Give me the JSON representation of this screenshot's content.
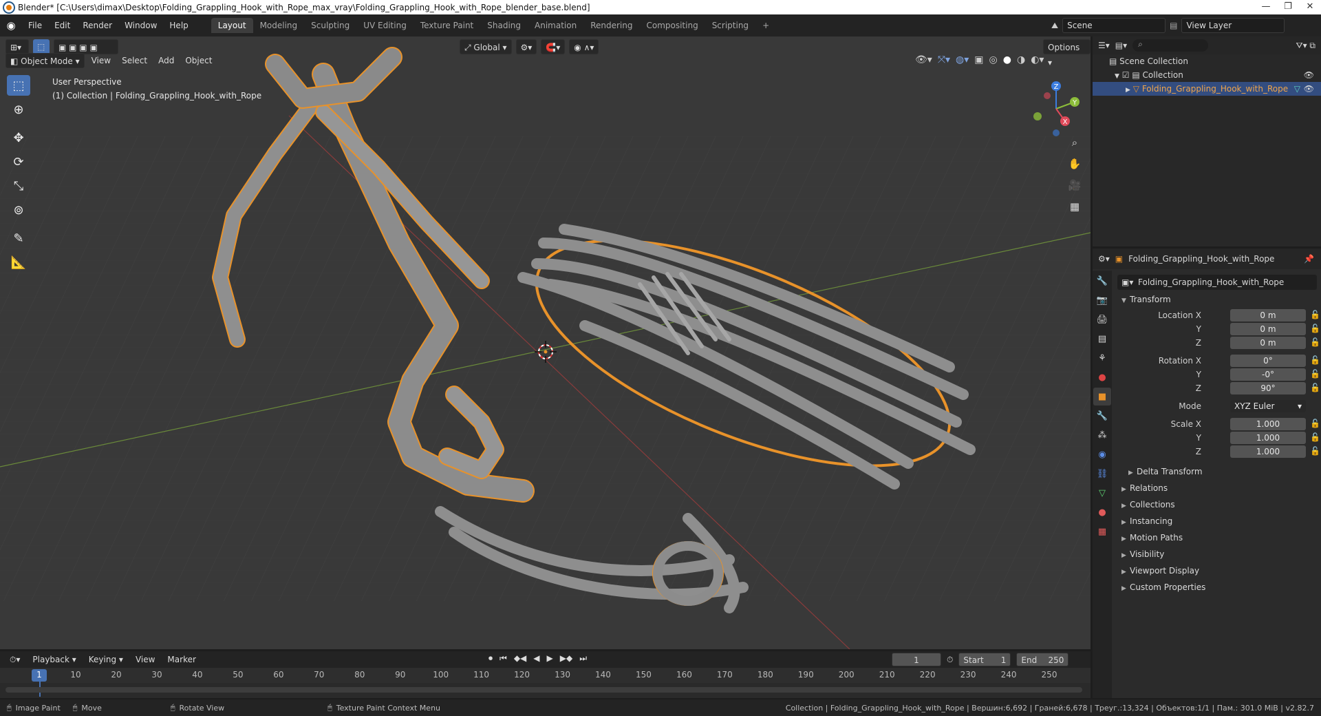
{
  "window": {
    "title": "Blender* [C:\\Users\\dimax\\Desktop\\Folding_Grappling_Hook_with_Rope_max_vray\\Folding_Grappling_Hook_with_Rope_blender_base.blend]",
    "minimize": "—",
    "maximize": "❐",
    "close": "✕"
  },
  "topbar": {
    "menus": [
      "File",
      "Edit",
      "Render",
      "Window",
      "Help"
    ],
    "workspaces": [
      "Layout",
      "Modeling",
      "Sculpting",
      "UV Editing",
      "Texture Paint",
      "Shading",
      "Animation",
      "Rendering",
      "Compositing",
      "Scripting"
    ],
    "active_workspace": "Layout",
    "add_workspace": "+",
    "scene": "Scene",
    "view_layer": "View Layer"
  },
  "viewport": {
    "mode": "Object Mode",
    "menus": [
      "View",
      "Select",
      "Add",
      "Object"
    ],
    "orientation": "Global",
    "options": "Options",
    "overlay_line1": "User Perspective",
    "overlay_line2": "(1) Collection | Folding_Grappling_Hook_with_Rope",
    "gizmo": {
      "z": "Z",
      "y": "Y",
      "x": "X"
    }
  },
  "outliner": {
    "scene_collection": "Scene Collection",
    "collection": "Collection",
    "object": "Folding_Grappling_Hook_with_Rope"
  },
  "properties": {
    "header_object": "Folding_Grappling_Hook_with_Rope",
    "name_field": "Folding_Grappling_Hook_with_Rope",
    "transform_label": "Transform",
    "location": {
      "x_label": "Location X",
      "x": "0 m",
      "y_label": "Y",
      "y": "0 m",
      "z_label": "Z",
      "z": "0 m"
    },
    "rotation": {
      "x_label": "Rotation X",
      "x": "0°",
      "y_label": "Y",
      "y": "-0°",
      "z_label": "Z",
      "z": "90°"
    },
    "mode": {
      "label": "Mode",
      "value": "XYZ Euler"
    },
    "scale": {
      "x_label": "Scale X",
      "x": "1.000",
      "y_label": "Y",
      "y": "1.000",
      "z_label": "Z",
      "z": "1.000"
    },
    "delta_transform": "Delta Transform",
    "panels": [
      "Relations",
      "Collections",
      "Instancing",
      "Motion Paths",
      "Visibility",
      "Viewport Display",
      "Custom Properties"
    ]
  },
  "timeline": {
    "menus": [
      "Playback",
      "Keying",
      "View",
      "Marker"
    ],
    "current_frame": "1",
    "start_label": "Start",
    "start": "1",
    "end_label": "End",
    "end": "250",
    "ticks": [
      "1",
      "10",
      "20",
      "30",
      "40",
      "50",
      "60",
      "70",
      "80",
      "90",
      "100",
      "110",
      "120",
      "130",
      "140",
      "150",
      "160",
      "170",
      "180",
      "190",
      "200",
      "210",
      "220",
      "230",
      "240",
      "250"
    ]
  },
  "statusbar": {
    "image_paint": "Image Paint",
    "move": "Move",
    "rotate_view": "Rotate View",
    "context_menu": "Texture Paint Context Menu",
    "stats": "Collection | Folding_Grappling_Hook_with_Rope | Вершин:6,692 | Граней:6,678 | Треуг.:13,324 | Объектов:1/1 | Пам.: 301.0 MiB | v2.82.7"
  },
  "colors": {
    "selection_outline": "#e8922a",
    "active_blue": "#4772b3",
    "viewport_bg": "#393939"
  }
}
